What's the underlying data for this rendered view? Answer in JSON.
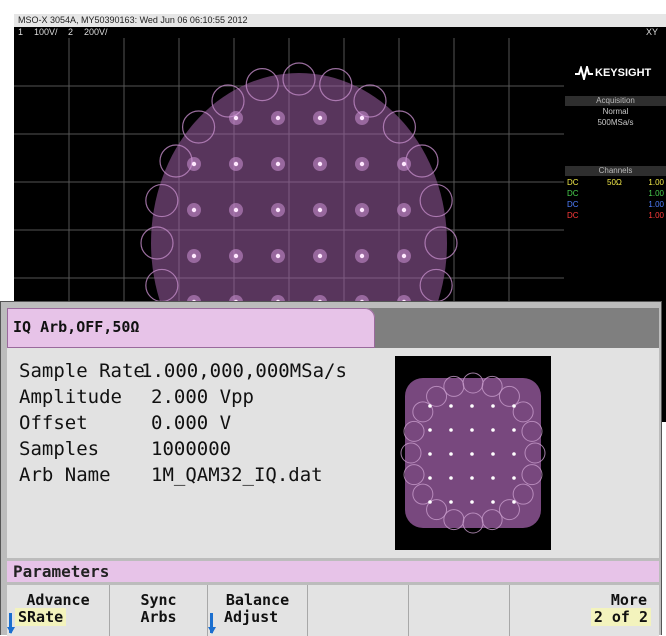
{
  "scope": {
    "title_bar": "MSO-X 3054A, MY50390163: Wed Jun 06 06:10:55 2012",
    "channels_bar": {
      "ch1_num": "1",
      "ch1_scale": "100V/",
      "ch2_num": "2",
      "ch2_scale": "200V/"
    },
    "mode": "XY",
    "brand": "KEYSIGHT",
    "acquisition": {
      "title": "Acquisition",
      "mode": "Normal",
      "rate": "500MSa/s"
    },
    "channels": {
      "title": "Channels",
      "rows": [
        {
          "coupling": "DC",
          "impedance": "50Ω",
          "scale": "1.00",
          "color": "#f2e94a"
        },
        {
          "coupling": "DC",
          "impedance": "",
          "scale": "1.00",
          "color": "#49d14f"
        },
        {
          "coupling": "DC",
          "impedance": "",
          "scale": "1.00",
          "color": "#4f7fff"
        },
        {
          "coupling": "DC",
          "impedance": "",
          "scale": "1.00",
          "color": "#ff3b3b"
        }
      ]
    },
    "trace_color": "#a060a8"
  },
  "generator": {
    "tab_label": "IQ Arb,OFF,50Ω",
    "params": [
      {
        "label": "Sample Rate",
        "value": "1.000,000,000MSa/s"
      },
      {
        "label": "Amplitude",
        "value": "2.000 Vpp"
      },
      {
        "label": "Offset",
        "value": "0.000 V"
      },
      {
        "label": "Samples",
        "value": "1000000"
      },
      {
        "label": "Arb Name",
        "value": "1M_QAM32_IQ.dat"
      }
    ],
    "section_label": "Parameters",
    "softkeys": [
      {
        "line1": "Advance",
        "line2": "SRate"
      },
      {
        "line1": "Sync",
        "line2": "Arbs"
      },
      {
        "line1": "Balance",
        "line2": "Adjust"
      },
      {
        "line1": "",
        "line2": ""
      },
      {
        "line1": "",
        "line2": ""
      },
      {
        "line1": "More",
        "line2": "2 of 2"
      }
    ]
  }
}
